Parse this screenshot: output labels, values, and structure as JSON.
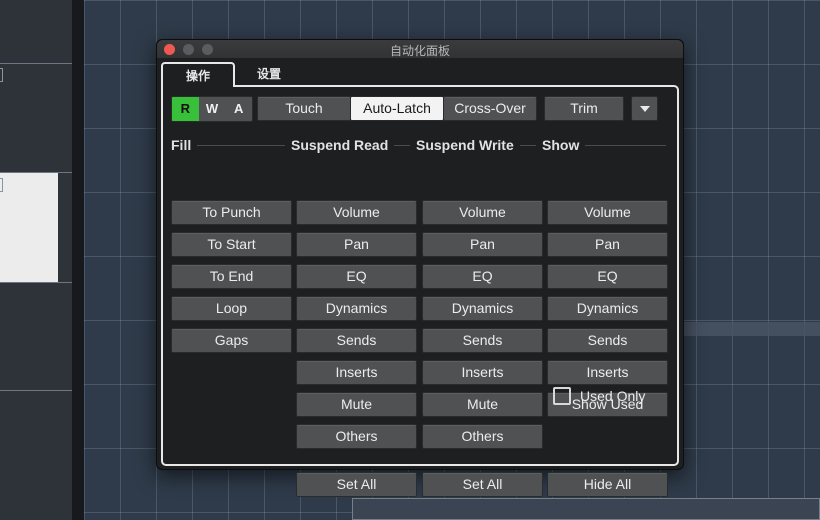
{
  "window": {
    "title": "自动化面板"
  },
  "tabs": {
    "operate": "操作",
    "settings": "设置"
  },
  "rwa": {
    "r": "R",
    "w": "W",
    "a": "A"
  },
  "modes": {
    "touch": "Touch",
    "auto_latch": "Auto-Latch",
    "cross_over": "Cross-Over",
    "trim": "Trim",
    "selected": "Auto-Latch"
  },
  "sections": {
    "fill": {
      "title": "Fill",
      "items": [
        "To Punch",
        "To Start",
        "To End",
        "Loop",
        "Gaps"
      ]
    },
    "suspend_read": {
      "title": "Suspend Read",
      "items": [
        "Volume",
        "Pan",
        "EQ",
        "Dynamics",
        "Sends",
        "Inserts",
        "Mute",
        "Others"
      ],
      "all_label": "Set All"
    },
    "suspend_write": {
      "title": "Suspend Write",
      "items": [
        "Volume",
        "Pan",
        "EQ",
        "Dynamics",
        "Sends",
        "Inserts",
        "Mute",
        "Others"
      ],
      "all_label": "Set All"
    },
    "show": {
      "title": "Show",
      "items": [
        "Volume",
        "Pan",
        "EQ",
        "Dynamics",
        "Sends",
        "Inserts",
        "Show Used"
      ],
      "used_only_label": "Used Only",
      "used_only_checked": false,
      "all_label": "Hide All"
    }
  },
  "colors": {
    "record_active": "#39c03b",
    "close_button": "#ee5a52"
  }
}
